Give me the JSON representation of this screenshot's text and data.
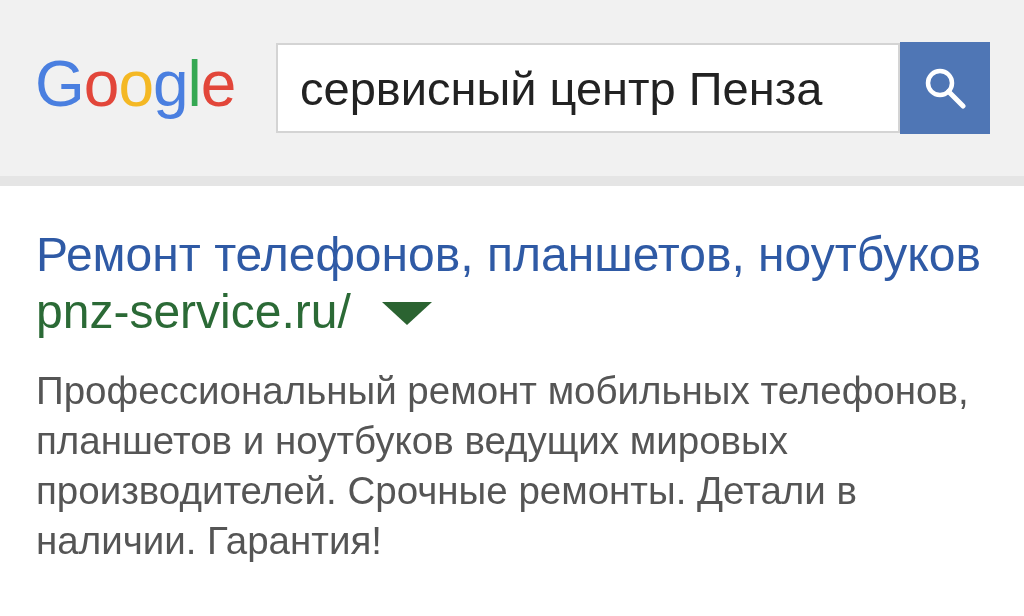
{
  "header": {
    "logo": "Google",
    "search": {
      "value": "сервисный центр Пенза"
    }
  },
  "result": {
    "title": "Ремонт телефонов, планшетов, ноутбуков",
    "url": "pnz-service.ru/",
    "snippet": "Профессиональный ремонт мобильных телефонов, планшетов и ноутбуков ведущих мировых производителей. Срочные ремонты. Детали в наличии. Гарантия!"
  }
}
